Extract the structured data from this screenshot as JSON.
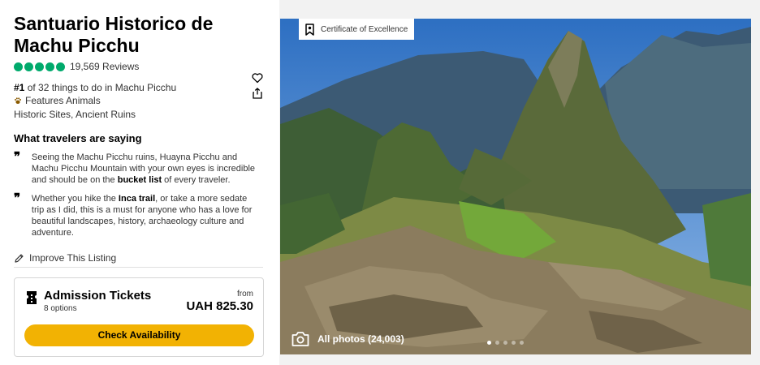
{
  "attraction": {
    "title": "Santuario Historico de Machu Picchu",
    "rating": 5,
    "reviews": "19,569 Reviews",
    "rank_number": "#1",
    "rank_text": " of 32 things to do in Machu Picchu",
    "feature": "Features Animals",
    "categories": "Historic Sites, Ancient Ruins"
  },
  "travelers": {
    "heading": "What travelers are saying",
    "quotes": [
      {
        "before": "Seeing the Machu Picchu ruins, Huayna Picchu and Machu Picchu Mountain with your own eyes is incredible and should be on the ",
        "bold": "bucket list",
        "after": " of every traveler."
      },
      {
        "before": "Whether you hike the ",
        "bold": "Inca trail",
        "after": ", or take a more sedate trip as I did, this is a must for anyone who has a love for beautiful landscapes, history, archaeology culture and adventure."
      }
    ]
  },
  "improve_label": "Improve This Listing",
  "tickets": {
    "title": "Admission Tickets",
    "options": "8 options",
    "from_label": "from",
    "price": "UAH 825.30",
    "button_label": "Check Availability"
  },
  "photo": {
    "certificate": "Certificate of Excellence",
    "all_photos": "All photos (24,003)",
    "dot_count": 5,
    "active_dot": 1
  },
  "icons": [
    "heart-icon",
    "share-icon",
    "paw-icon",
    "quote-icon",
    "pencil-icon",
    "ticket-icon",
    "award-icon",
    "camera-icon"
  ],
  "colors": {
    "rating_green": "#00aa6c",
    "button_yellow": "#f2b203"
  }
}
